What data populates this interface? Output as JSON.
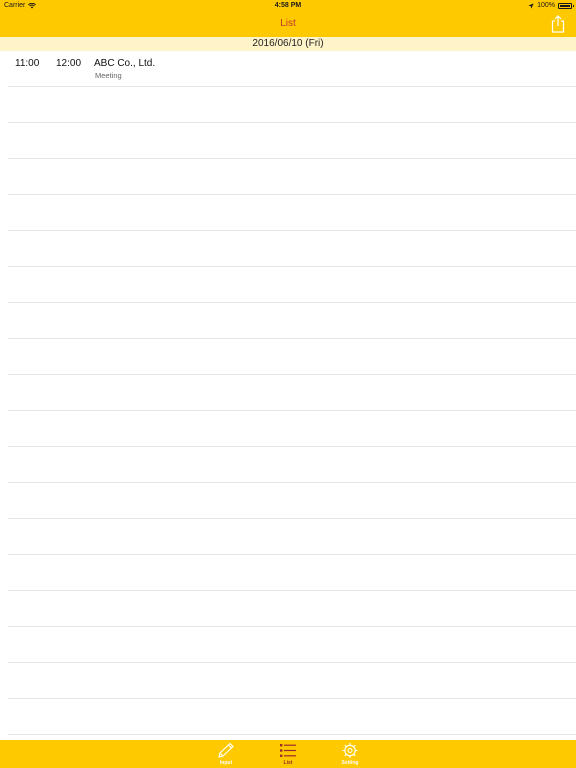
{
  "status_bar": {
    "carrier": "Carrier",
    "time": "4:58 PM",
    "battery": "100%"
  },
  "nav": {
    "title": "List"
  },
  "section": {
    "date": "2016/06/10 (Fri)"
  },
  "rows": [
    {
      "start": "11:00",
      "end": "12:00",
      "title": "ABC Co., Ltd.",
      "subtitle": "Meeting"
    }
  ],
  "tabs": [
    {
      "label": "Input",
      "icon": "pencil-icon",
      "selected": false
    },
    {
      "label": "List",
      "icon": "list-icon",
      "selected": true
    },
    {
      "label": "Setting",
      "icon": "gear-icon",
      "selected": false
    }
  ],
  "colors": {
    "bar": "#ffc900",
    "section_bg": "#fff3c9",
    "title": "#c0392b",
    "selected_tab": "#9b2c2c"
  }
}
